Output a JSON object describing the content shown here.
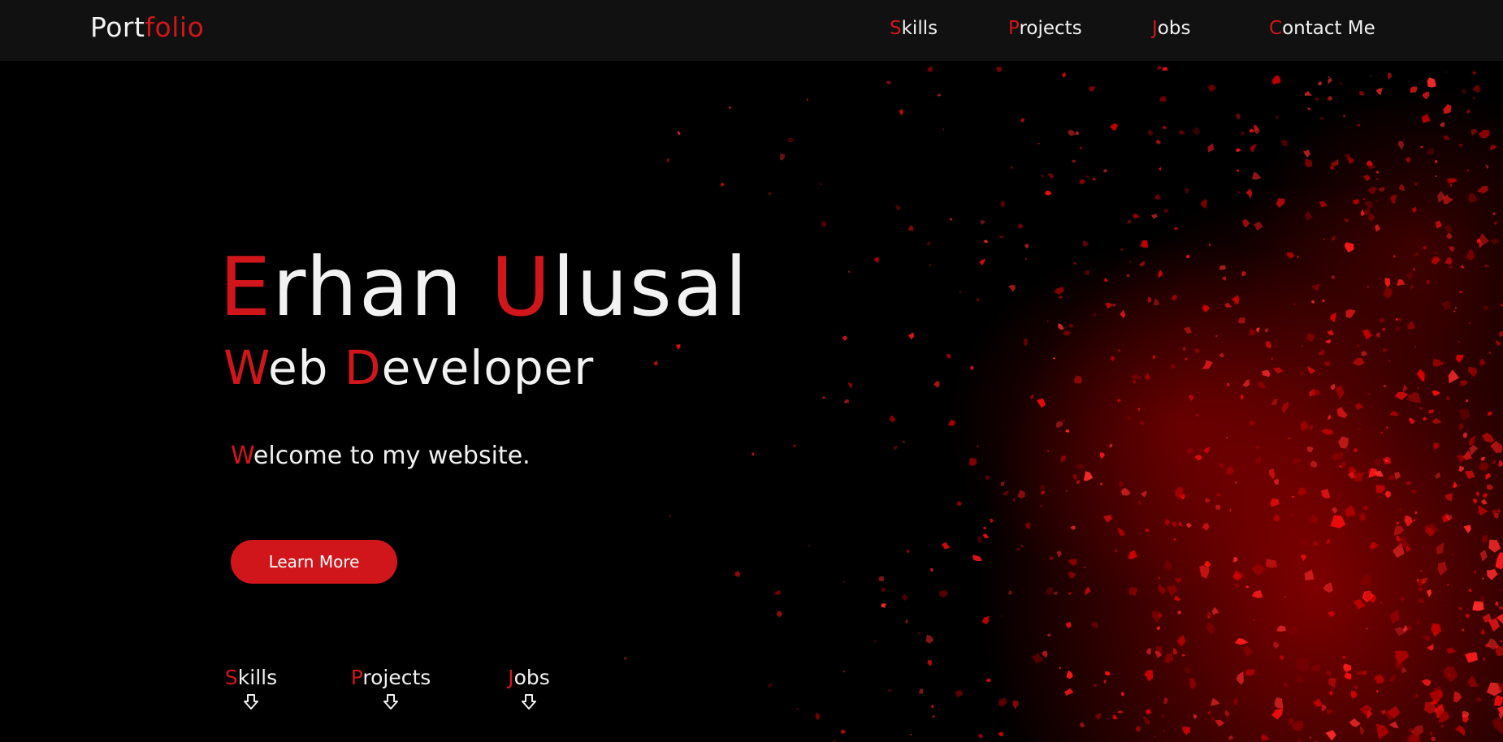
{
  "header": {
    "brand_first": "Port",
    "brand_second": "folio",
    "nav": [
      {
        "first": "S",
        "rest": "kills"
      },
      {
        "first": "P",
        "rest": "rojects"
      },
      {
        "first": "J",
        "rest": "obs"
      },
      {
        "first": "C",
        "rest": "ontact Me"
      }
    ]
  },
  "hero": {
    "name_first_initial": "E",
    "name_first_rest": "rhan",
    "name_last_initial": "U",
    "name_last_rest": "lusal",
    "role_first_initial": "W",
    "role_first_rest": "eb",
    "role_last_initial": "D",
    "role_last_rest": "eveloper",
    "welcome_initial": "W",
    "welcome_rest": "elcome to my website.",
    "cta_label": "Learn More"
  },
  "quick_links": [
    {
      "first": "S",
      "rest": "kills",
      "icon": "arrow-down-icon"
    },
    {
      "first": "P",
      "rest": "rojects",
      "icon": "arrow-down-icon"
    },
    {
      "first": "J",
      "rest": "obs",
      "icon": "arrow-down-icon"
    }
  ],
  "colors": {
    "accent": "#d0161b",
    "header_bg": "#111111",
    "page_bg": "#000000",
    "text": "#f2f2f2"
  }
}
